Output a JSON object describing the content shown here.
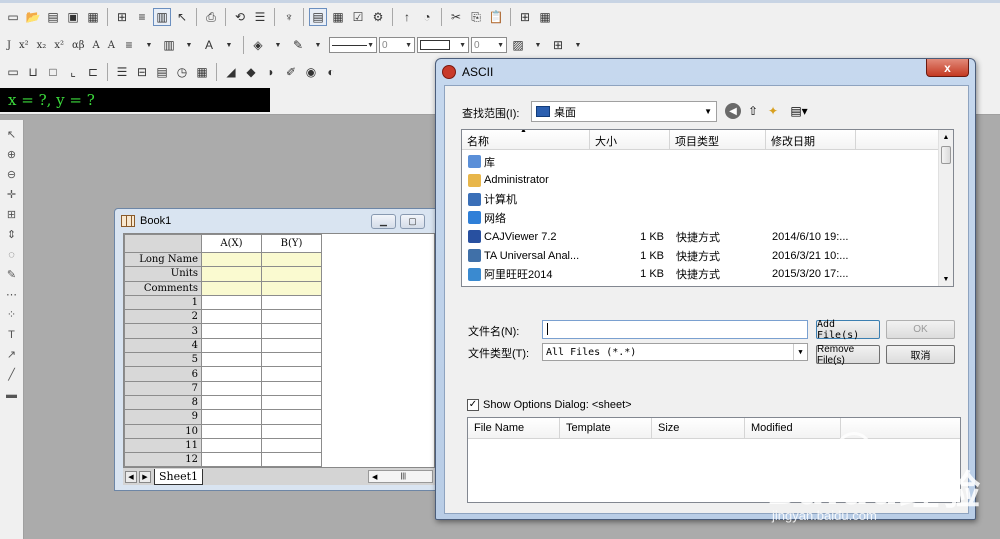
{
  "toolbar": {
    "row2_text": [
      "J",
      "x²",
      "x₂",
      "x²",
      "αβ",
      "A",
      "A"
    ],
    "line_width_value": "0",
    "border_width_value": "0"
  },
  "coord_readout": "x = ?, y = ?",
  "book": {
    "title": "Book1",
    "columns": [
      "A(X)",
      "B(Y)"
    ],
    "meta_rows": [
      "Long Name",
      "Units",
      "Comments"
    ],
    "row_numbers": [
      "1",
      "2",
      "3",
      "4",
      "5",
      "6",
      "7",
      "8",
      "9",
      "10",
      "11",
      "12"
    ],
    "sheet_tab": "Sheet1"
  },
  "dialog": {
    "title": "ASCII",
    "close_label": "x",
    "look_in_label": "查找范围(I):",
    "look_in_value": "桌面",
    "columns": {
      "name": "名称",
      "size": "大小",
      "type": "项目类型",
      "date": "修改日期"
    },
    "files": [
      {
        "name": "库",
        "size": "",
        "type": "",
        "date": "",
        "icon": "library-icon",
        "color": "#5a8fd8"
      },
      {
        "name": "Administrator",
        "size": "",
        "type": "",
        "date": "",
        "icon": "user-folder-icon",
        "color": "#e8b64a"
      },
      {
        "name": "计算机",
        "size": "",
        "type": "",
        "date": "",
        "icon": "computer-icon",
        "color": "#3a6fb8"
      },
      {
        "name": "网络",
        "size": "",
        "type": "",
        "date": "",
        "icon": "network-icon",
        "color": "#2f7fd8"
      },
      {
        "name": "CAJViewer 7.2",
        "size": "1 KB",
        "type": "快捷方式",
        "date": "2014/6/10 19:...",
        "icon": "cajviewer-icon",
        "color": "#2850a0"
      },
      {
        "name": "TA Universal Anal...",
        "size": "1 KB",
        "type": "快捷方式",
        "date": "2016/3/21 10:...",
        "icon": "ta-icon",
        "color": "#4070a8"
      },
      {
        "name": "阿里旺旺2014",
        "size": "1 KB",
        "type": "快捷方式",
        "date": "2015/3/20 17:...",
        "icon": "aliwangwang-icon",
        "color": "#3a8ad0"
      }
    ],
    "file_name_label": "文件名(N):",
    "file_name_value": "",
    "file_type_label": "文件类型(T):",
    "file_type_value": "All Files (*.*)",
    "buttons": {
      "add": "Add File(s)",
      "ok": "OK",
      "remove": "Remove File(s)",
      "cancel": "取消"
    },
    "show_options_label": "Show Options Dialog: <sheet>",
    "show_options_checked": true,
    "selected_columns": [
      "File Name",
      "Template",
      "Size",
      "Modified"
    ]
  },
  "watermark": {
    "brand": "Baidu经验",
    "url": "jingyan.baidu.com"
  }
}
